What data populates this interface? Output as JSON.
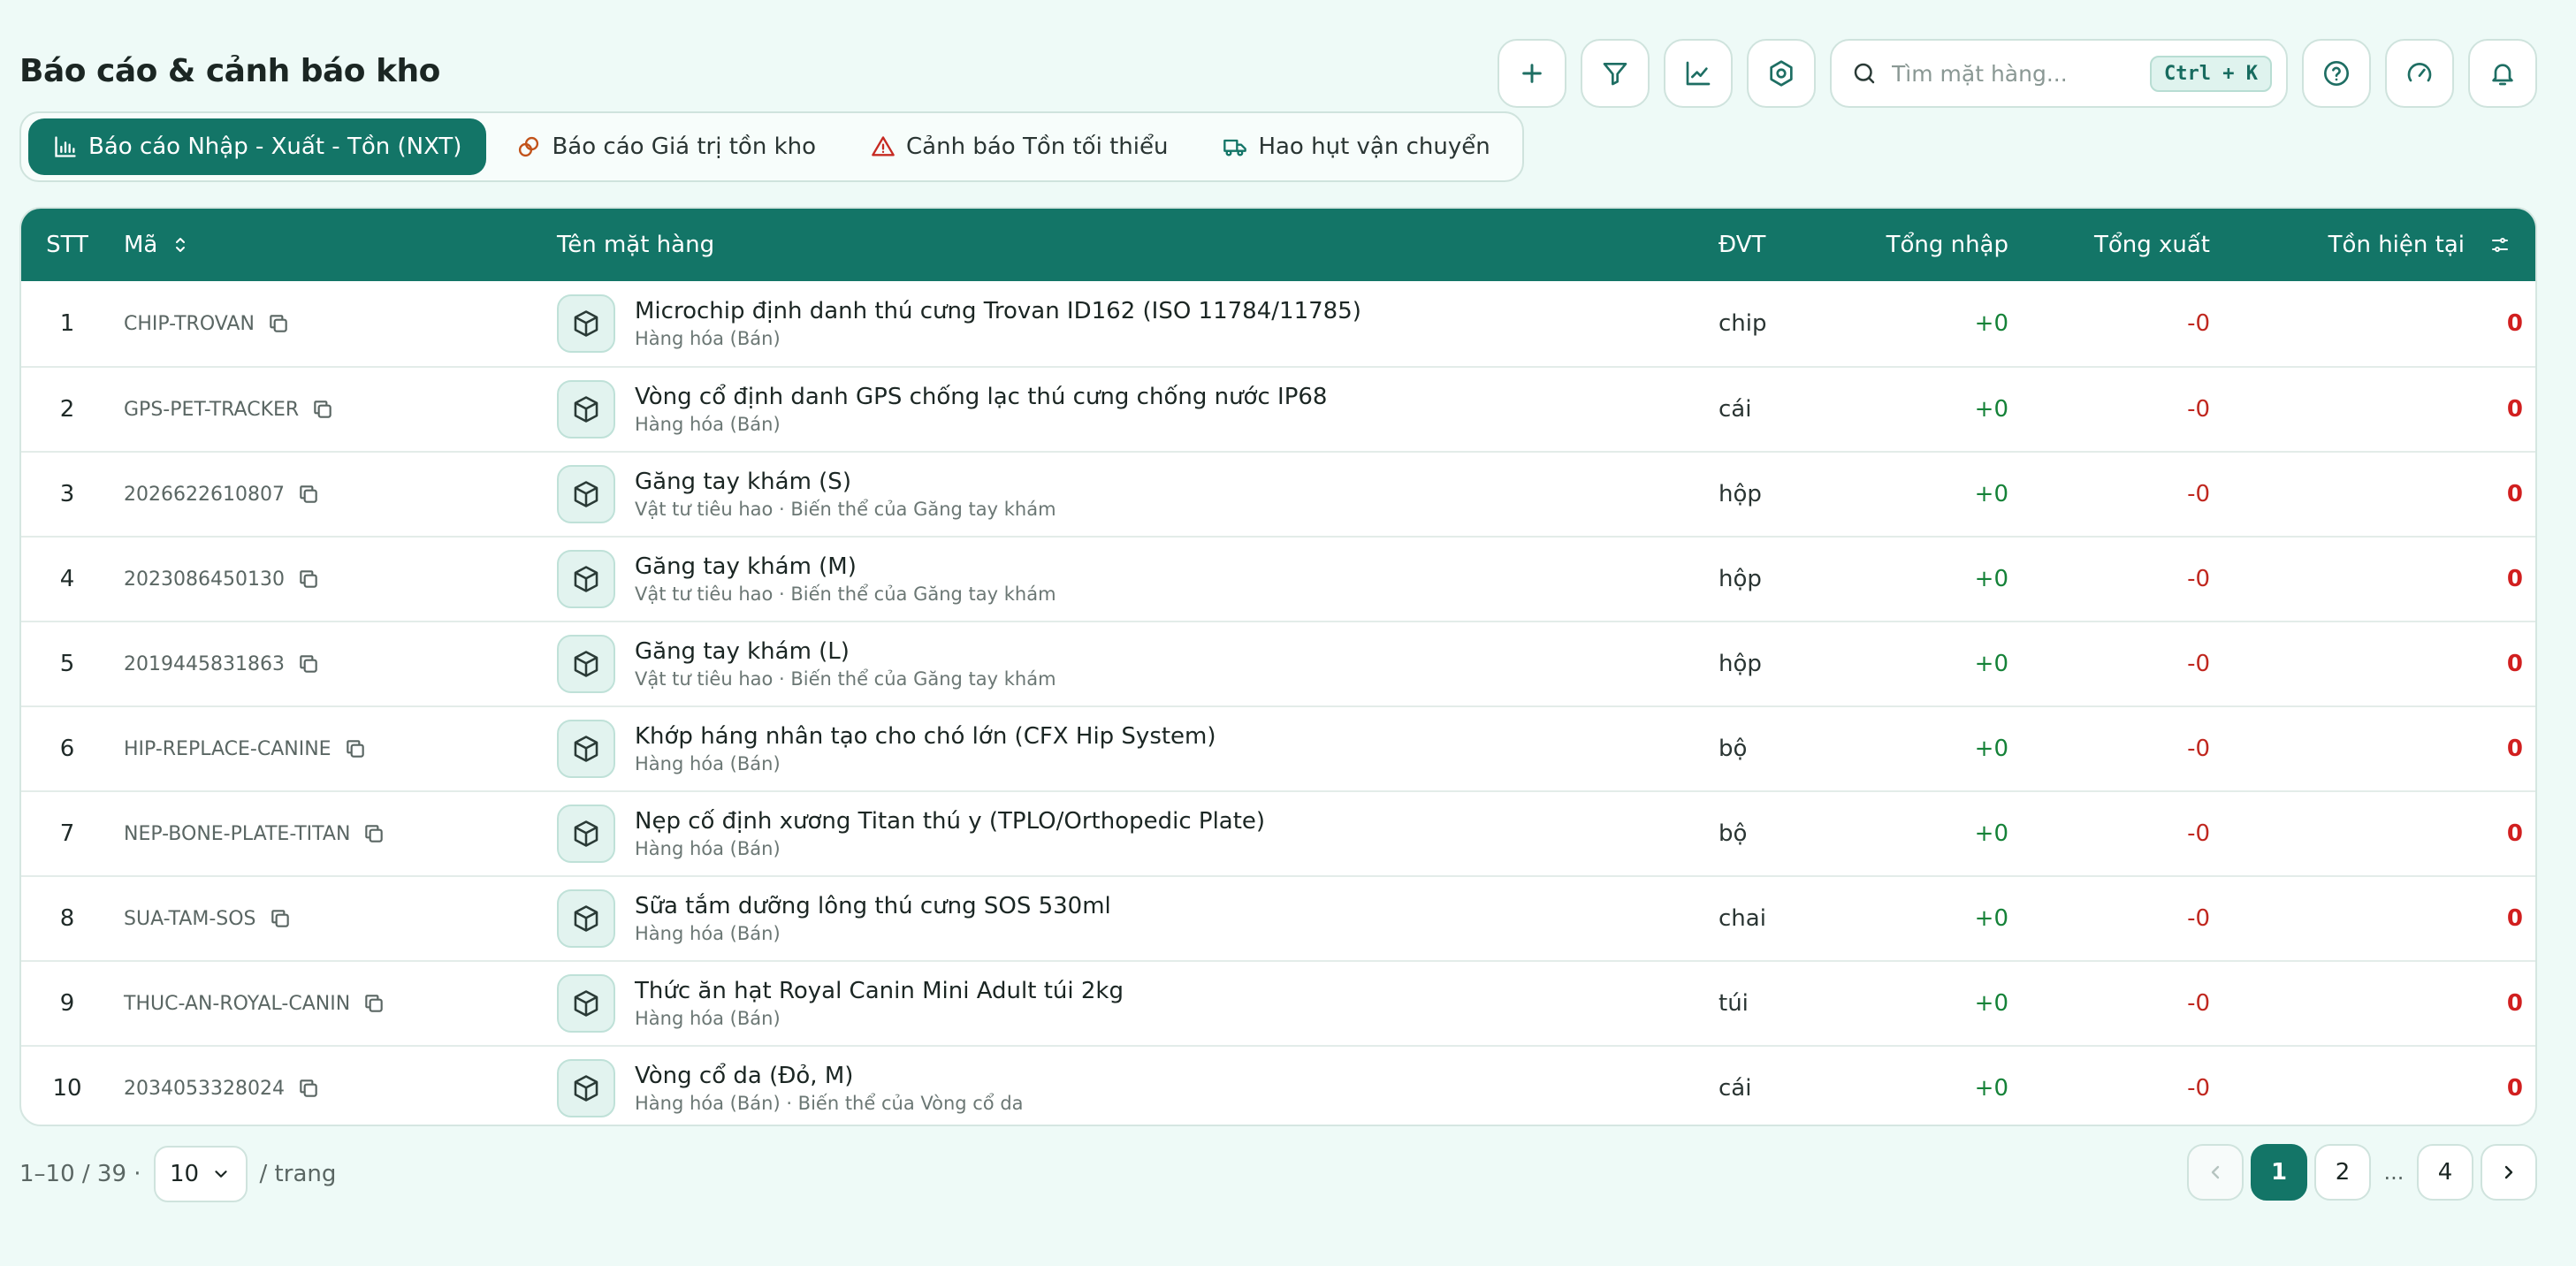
{
  "page": {
    "title": "Báo cáo & cảnh báo kho"
  },
  "search": {
    "placeholder": "Tìm mặt hàng...",
    "shortcut": "Ctrl + K"
  },
  "tabs": [
    {
      "label": "Báo cáo Nhập - Xuất - Tồn (NXT)",
      "icon": "bar-chart-icon",
      "active": true
    },
    {
      "label": "Báo cáo Giá trị tồn kho",
      "icon": "coins-icon",
      "active": false
    },
    {
      "label": "Cảnh báo Tồn tối thiểu",
      "icon": "warning-icon",
      "active": false
    },
    {
      "label": "Hao hụt vận chuyển",
      "icon": "truck-icon",
      "active": false
    }
  ],
  "table": {
    "headers": {
      "stt": "STT",
      "code": "Mã",
      "name": "Tên mặt hàng",
      "unit": "ĐVT",
      "total_in": "Tổng nhập",
      "total_out": "Tổng xuất",
      "stock": "Tồn hiện tại"
    },
    "rows": [
      {
        "stt": "1",
        "code": "CHIP-TROVAN",
        "name": "Microchip định danh thú cưng Trovan ID162 (ISO 11784/11785)",
        "sub": "Hàng hóa (Bán)",
        "unit": "chip",
        "in": "+0",
        "out": "-0",
        "stock": "0"
      },
      {
        "stt": "2",
        "code": "GPS-PET-TRACKER",
        "name": "Vòng cổ định danh GPS chống lạc thú cưng chống nước IP68",
        "sub": "Hàng hóa (Bán)",
        "unit": "cái",
        "in": "+0",
        "out": "-0",
        "stock": "0"
      },
      {
        "stt": "3",
        "code": "2026622610807",
        "name": "Găng tay khám (S)",
        "sub": "Vật tư tiêu hao · Biến thể của Găng tay khám",
        "unit": "hộp",
        "in": "+0",
        "out": "-0",
        "stock": "0"
      },
      {
        "stt": "4",
        "code": "2023086450130",
        "name": "Găng tay khám (M)",
        "sub": "Vật tư tiêu hao · Biến thể của Găng tay khám",
        "unit": "hộp",
        "in": "+0",
        "out": "-0",
        "stock": "0"
      },
      {
        "stt": "5",
        "code": "2019445831863",
        "name": "Găng tay khám (L)",
        "sub": "Vật tư tiêu hao · Biến thể của Găng tay khám",
        "unit": "hộp",
        "in": "+0",
        "out": "-0",
        "stock": "0"
      },
      {
        "stt": "6",
        "code": "HIP-REPLACE-CANINE",
        "name": "Khớp háng nhân tạo cho chó lớn (CFX Hip System)",
        "sub": "Hàng hóa (Bán)",
        "unit": "bộ",
        "in": "+0",
        "out": "-0",
        "stock": "0"
      },
      {
        "stt": "7",
        "code": "NEP-BONE-PLATE-TITAN",
        "name": "Nẹp cố định xương Titan thú y (TPLO/Orthopedic Plate)",
        "sub": "Hàng hóa (Bán)",
        "unit": "bộ",
        "in": "+0",
        "out": "-0",
        "stock": "0"
      },
      {
        "stt": "8",
        "code": "SUA-TAM-SOS",
        "name": "Sữa tắm dưỡng lông thú cưng SOS 530ml",
        "sub": "Hàng hóa (Bán)",
        "unit": "chai",
        "in": "+0",
        "out": "-0",
        "stock": "0"
      },
      {
        "stt": "9",
        "code": "THUC-AN-ROYAL-CANIN",
        "name": "Thức ăn hạt Royal Canin Mini Adult túi 2kg",
        "sub": "Hàng hóa (Bán)",
        "unit": "túi",
        "in": "+0",
        "out": "-0",
        "stock": "0"
      },
      {
        "stt": "10",
        "code": "2034053328024",
        "name": "Vòng cổ da (Đỏ, M)",
        "sub": "Hàng hóa (Bán) · Biến thể của Vòng cổ da",
        "unit": "cái",
        "in": "+0",
        "out": "-0",
        "stock": "0"
      }
    ]
  },
  "footer": {
    "range": "1–10 / 39 ·",
    "page_size": "10",
    "per_page": "/ trang",
    "pages": [
      "1",
      "2",
      "...",
      "4"
    ],
    "current_page": "1"
  },
  "colors": {
    "primary": "#137567",
    "background": "#eefaf7",
    "positive": "#158238",
    "negative": "#c0271f"
  }
}
